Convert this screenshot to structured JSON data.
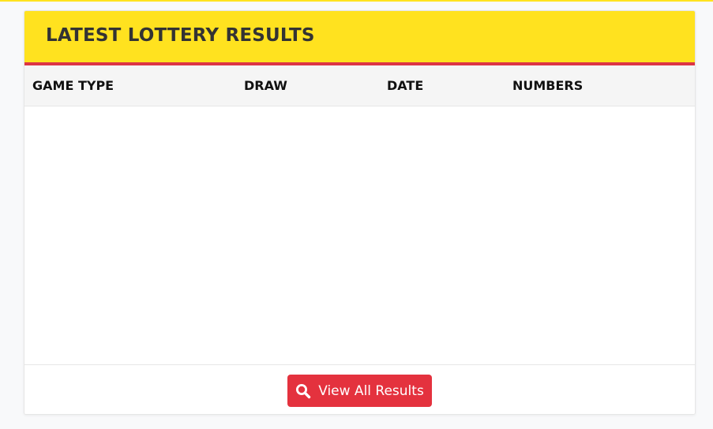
{
  "card": {
    "title": "LATEST LOTTERY RESULTS"
  },
  "table": {
    "columns": [
      "GAME TYPE",
      "DRAW",
      "DATE",
      "NUMBERS"
    ],
    "rows": []
  },
  "footer": {
    "button_label": "View All Results",
    "button_icon": "search-icon"
  },
  "colors": {
    "header_bg": "#ffe21f",
    "header_accent": "#dc3545",
    "button_bg": "#e4323e",
    "page_bg": "#f8f9fa"
  }
}
